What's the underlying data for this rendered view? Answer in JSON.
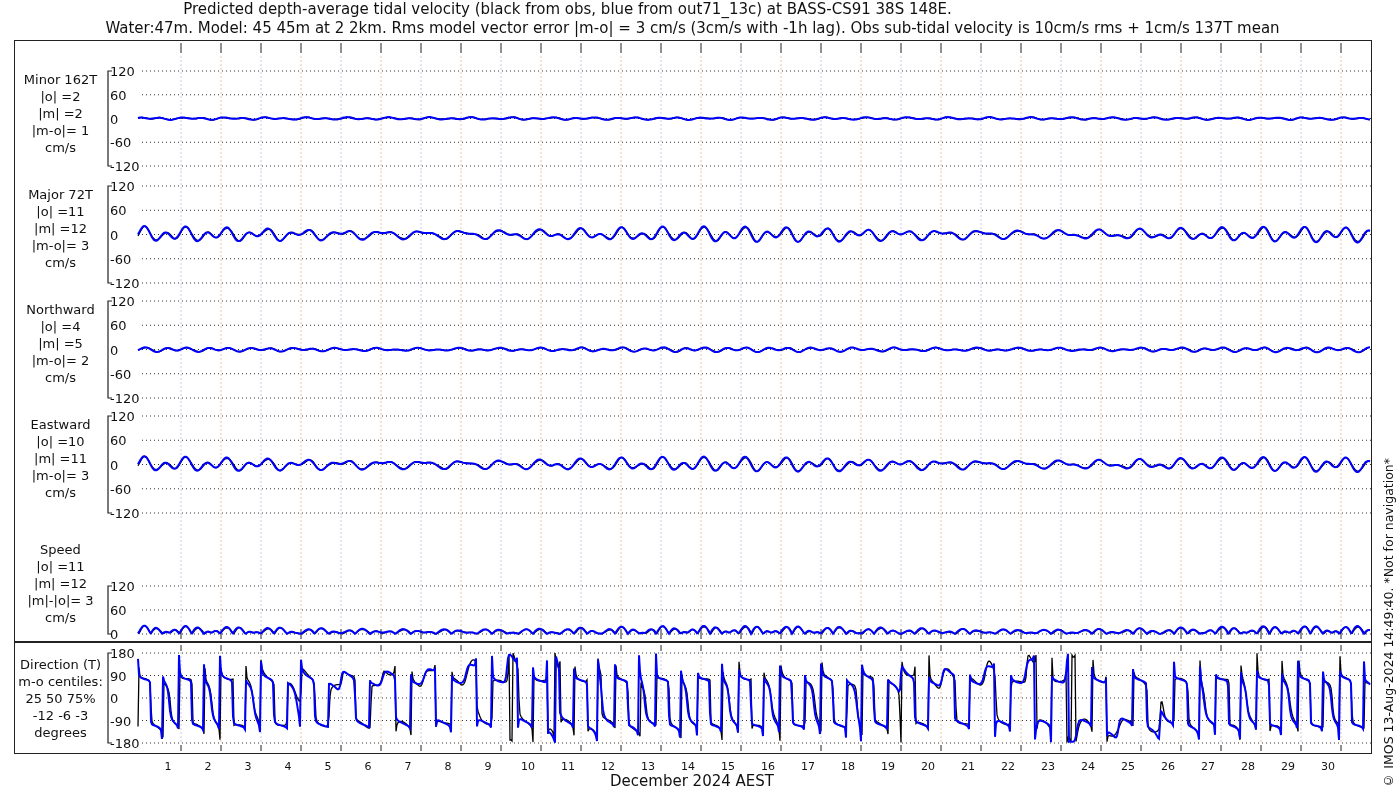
{
  "title_lines": [
    "Predicted depth-average tidal velocity (black from obs, blue from out71_13c) at BASS-CS91 38S 148E.",
    "Water:47m. Model: 45 45m at 2 2km. Rms model vector error |m-o| = 3 cm/s (3cm/s with -1h lag). Obs sub-tidal velocity is 10cm/s rms + 1cm/s 137T mean"
  ],
  "panels": [
    {
      "kind": "minor",
      "label_lines": [
        "Minor 162T",
        "|o| =2",
        "|m| =2",
        "|m-o|= 1",
        "cm/s"
      ],
      "yticks": [
        "120",
        "60",
        "0",
        "-60",
        "-120"
      ]
    },
    {
      "kind": "major",
      "label_lines": [
        "Major 72T",
        "|o| =11",
        "|m| =12",
        "|m-o|= 3",
        "cm/s"
      ],
      "yticks": [
        "120",
        "60",
        "0",
        "-60",
        "-120"
      ]
    },
    {
      "kind": "north",
      "label_lines": [
        "Northward",
        "|o| =4",
        "|m| =5",
        "|m-o|= 2",
        "cm/s"
      ],
      "yticks": [
        "120",
        "60",
        "0",
        "-60",
        "-120"
      ]
    },
    {
      "kind": "east",
      "label_lines": [
        "Eastward",
        "|o| =10",
        "|m| =11",
        "|m-o|= 3",
        "cm/s"
      ],
      "yticks": [
        "120",
        "60",
        "0",
        "-60",
        "-120"
      ]
    },
    {
      "kind": "speed",
      "label_lines": [
        "Speed",
        "|o| =11",
        "|m| =12",
        "|m|-|o|= 3",
        "cm/s"
      ],
      "yticks": [
        "120",
        "60",
        "0"
      ]
    },
    {
      "kind": "direction",
      "label_lines": [
        "Direction (T)",
        "m-o centiles:",
        "25  50  75%",
        "-12  -6  -3",
        "degrees"
      ],
      "yticks": [
        "180",
        "90",
        "0",
        "-90",
        "-180"
      ]
    }
  ],
  "day_labels": [
    "1",
    "2",
    "3",
    "4",
    "5",
    "6",
    "7",
    "8",
    "9",
    "10",
    "11",
    "12",
    "13",
    "14",
    "15",
    "16",
    "17",
    "18",
    "19",
    "20",
    "21",
    "22",
    "23",
    "24",
    "25",
    "26",
    "27",
    "28",
    "29",
    "30"
  ],
  "xlabel": "December 2024 AEST",
  "footer": "© IMOS 13-Aug-2024 14:49:40. *Not for navigation*"
}
